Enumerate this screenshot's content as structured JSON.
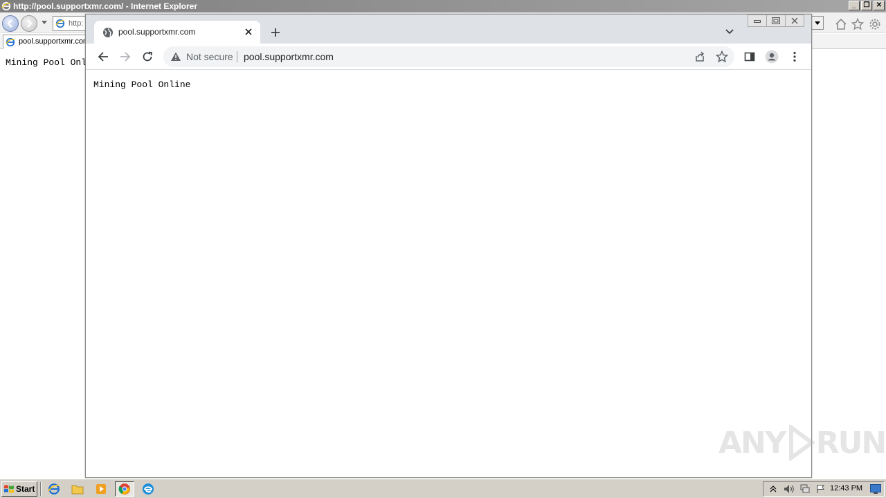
{
  "ie": {
    "title": "http://pool.supportxmr.com/ - Internet Explorer",
    "address_partial": "http:",
    "tab_label": "pool.supportxmr.com",
    "content_partial": "Mining Pool Onl",
    "window_buttons": [
      "_",
      "❐",
      "✕"
    ]
  },
  "chrome": {
    "tab_title": "pool.supportxmr.com",
    "security_label": "Not secure",
    "url": "pool.supportxmr.com",
    "page_text": "Mining Pool Online"
  },
  "watermark": {
    "text_left": "ANY",
    "text_right": "RUN"
  },
  "taskbar": {
    "start_label": "Start",
    "clock": "12:43 PM"
  },
  "colors": {
    "chrome_tabstrip": "#dee1e6",
    "omnibox_bg": "#f1f3f4",
    "taskbar_bg": "#d4d0c8"
  }
}
